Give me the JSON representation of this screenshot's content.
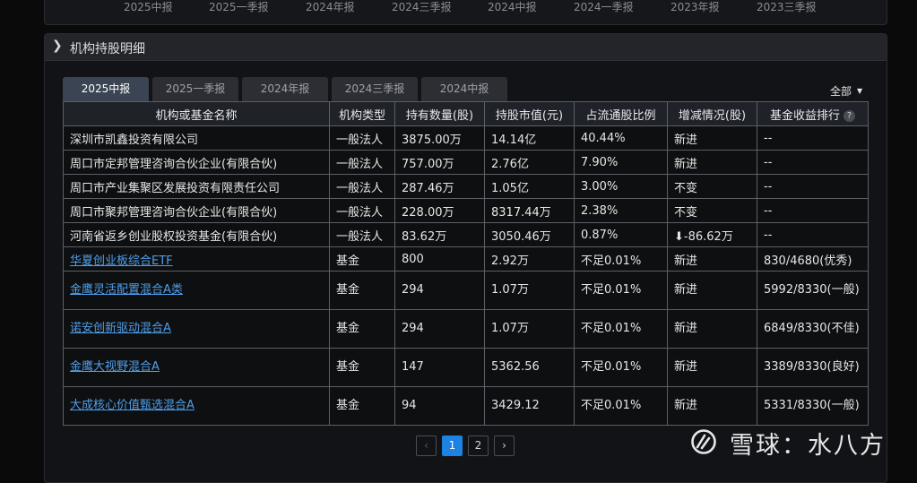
{
  "top_tabs": [
    "2025中报",
    "2025一季报",
    "2024年报",
    "2024三季报",
    "2024中报",
    "2024一季报",
    "2023年报",
    "2023三季报"
  ],
  "panel": {
    "title": "机构持股明细"
  },
  "tabs": [
    {
      "label": "2025中报",
      "active": true
    },
    {
      "label": "2025一季报",
      "active": false
    },
    {
      "label": "2024年报",
      "active": false
    },
    {
      "label": "2024三季报",
      "active": false
    },
    {
      "label": "2024中报",
      "active": false
    }
  ],
  "filter": {
    "label": "全部"
  },
  "columns": [
    "机构或基金名称",
    "机构类型",
    "持有数量(股)",
    "持股市值(元)",
    "占流通股比例",
    "增减情况(股)",
    "基金收益排行"
  ],
  "rows": [
    {
      "name": "深圳市凯鑫投资有限公司",
      "type": "一般法人",
      "qty": "3875.00万",
      "value": "14.14亿",
      "ratio": "40.44%",
      "change": "新进",
      "rank": "--"
    },
    {
      "name": "周口市定邦管理咨询合伙企业(有限合伙)",
      "type": "一般法人",
      "qty": "757.00万",
      "value": "2.76亿",
      "ratio": "7.90%",
      "change": "新进",
      "rank": "--"
    },
    {
      "name": "周口市产业集聚区发展投资有限责任公司",
      "type": "一般法人",
      "qty": "287.46万",
      "value": "1.05亿",
      "ratio": "3.00%",
      "change": "不变",
      "rank": "--"
    },
    {
      "name": "周口市聚邦管理咨询合伙企业(有限合伙)",
      "type": "一般法人",
      "qty": "228.00万",
      "value": "8317.44万",
      "ratio": "2.38%",
      "change": "不变",
      "rank": "--"
    },
    {
      "name": "河南省返乡创业股权投资基金(有限合伙)",
      "type": "一般法人",
      "qty": "83.62万",
      "value": "3050.46万",
      "ratio": "0.87%",
      "change_arrow": "⬇",
      "change": "-86.62万",
      "rank": "--"
    },
    {
      "name": "华夏创业板综合ETF",
      "type": "基金",
      "qty": "800",
      "value": "2.92万",
      "ratio": "不足0.01%",
      "change": "新进",
      "rank": "830/4680(优秀)"
    },
    {
      "name": "金鹰灵活配置混合A类",
      "type": "基金",
      "qty": "294",
      "value": "1.07万",
      "ratio": "不足0.01%",
      "change": "新进",
      "rank": "5992/8330(一般)"
    },
    {
      "name": "诺安创新驱动混合A",
      "type": "基金",
      "qty": "294",
      "value": "1.07万",
      "ratio": "不足0.01%",
      "change": "新进",
      "rank": "6849/8330(不佳)"
    },
    {
      "name": "金鹰大视野混合A",
      "type": "基金",
      "qty": "147",
      "value": "5362.56",
      "ratio": "不足0.01%",
      "change": "新进",
      "rank": "3389/8330(良好)"
    },
    {
      "name": "大成核心价值甄选混合A",
      "type": "基金",
      "qty": "94",
      "value": "3429.12",
      "ratio": "不足0.01%",
      "change": "新进",
      "rank": "5331/8330(一般)"
    }
  ],
  "pager": {
    "prev": "‹",
    "pages": [
      "1",
      "2"
    ],
    "current": "1",
    "next": "›"
  },
  "help_glyph": "?",
  "watermark": {
    "text": "雪球：水八方"
  },
  "colors": {
    "accent": "#1d82e2",
    "orange": "#f1a13a",
    "link": "#4f9fea",
    "down": "#35c24d"
  }
}
